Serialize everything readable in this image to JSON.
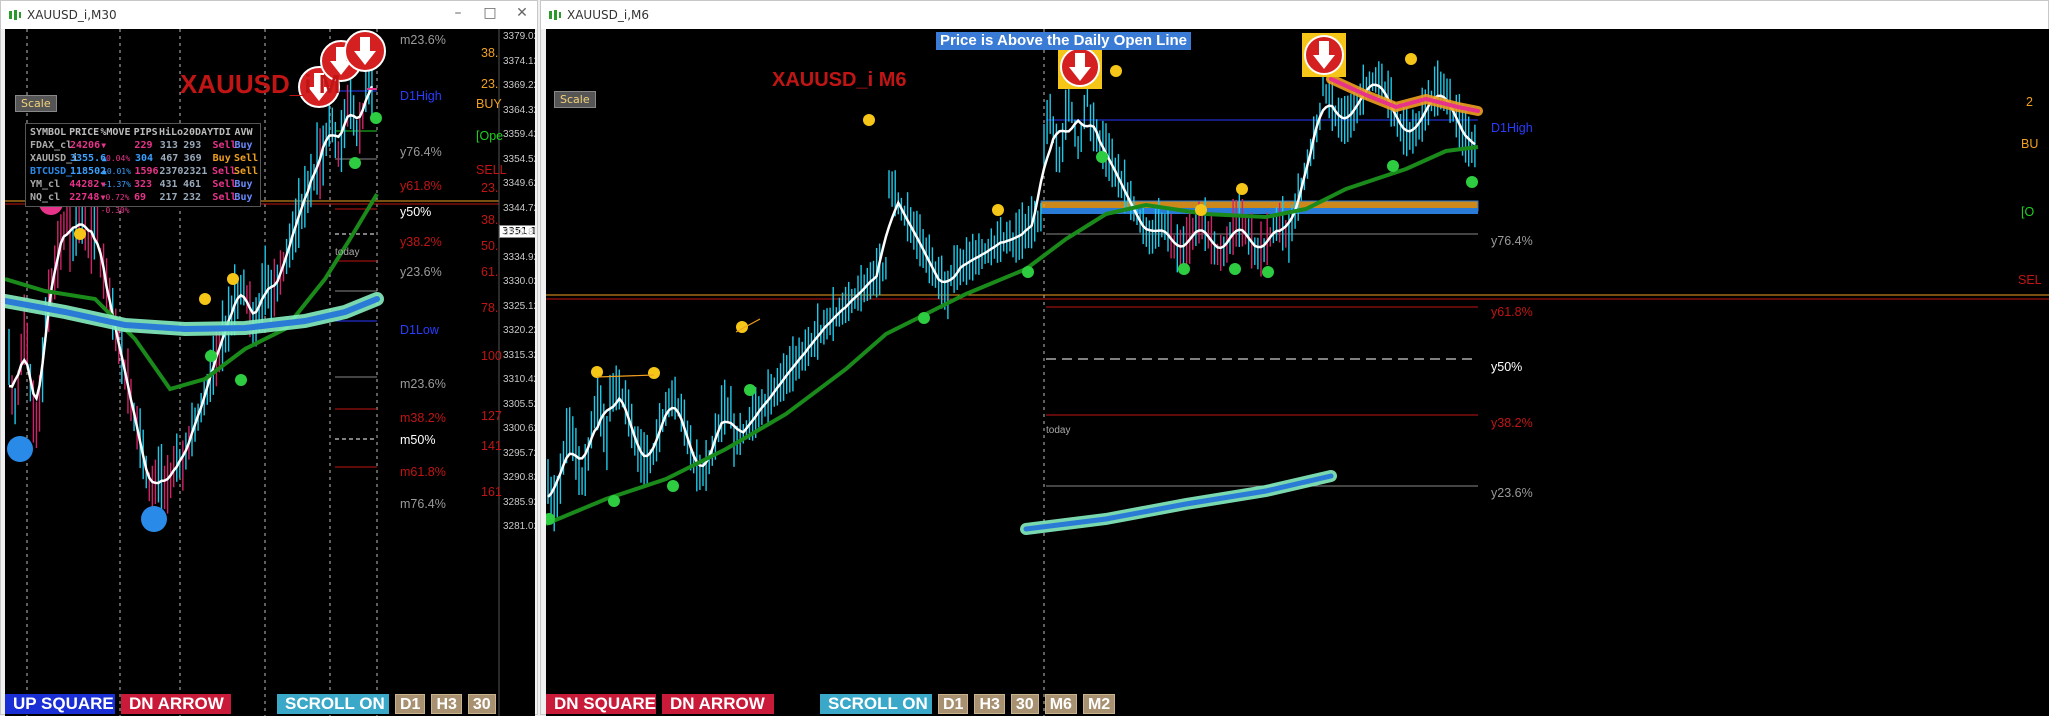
{
  "left_window": {
    "title": "XAUUSD_i,M30",
    "symbol_title": "XAUUSD_i M",
    "scale_label": "Scale",
    "today_label": "today",
    "price_tag": "3351.12",
    "price_axis": [
      "3379.02",
      "3374.12",
      "3369.22",
      "3364.32",
      "3359.42",
      "3354.52",
      "3349.62",
      "3344.72",
      "3339.82",
      "3334.92",
      "3330.02",
      "3325.12",
      "3320.22",
      "3315.32",
      "3310.42",
      "3305.52",
      "3300.62",
      "3295.72",
      "3290.82",
      "3285.92",
      "3281.02"
    ],
    "fib_labels": [
      {
        "text": "m23.6%",
        "color": "#9a9a9a"
      },
      {
        "text": "D1High",
        "color": "#2a3cff"
      },
      {
        "text": "y76.4%",
        "color": "#9a9a9a"
      },
      {
        "text": "y61.8%",
        "color": "#c11515"
      },
      {
        "text": "y50%",
        "color": "#ffffff"
      },
      {
        "text": "y38.2%",
        "color": "#c11515"
      },
      {
        "text": "y23.6%",
        "color": "#9a9a9a"
      },
      {
        "text": "D1Low",
        "color": "#2a3cff"
      },
      {
        "text": "m23.6%",
        "color": "#9a9a9a"
      },
      {
        "text": "m38.2%",
        "color": "#c11515"
      },
      {
        "text": "m50%",
        "color": "#ffffff"
      },
      {
        "text": "m61.8%",
        "color": "#c11515"
      },
      {
        "text": "m76.4%",
        "color": "#9a9a9a"
      }
    ],
    "side_numbers": [
      "38.",
      "23.",
      "23.",
      "38.",
      "50.",
      "61.",
      "78.",
      "100",
      "127",
      "141",
      "161"
    ],
    "side_words": [
      {
        "text": "BUY",
        "color": "#f0a020"
      },
      {
        "text": "[Ope",
        "color": "#1fd11f"
      },
      {
        "text": "SELL",
        "color": "#c11515"
      }
    ],
    "dashboard": {
      "headers": [
        "SYMBOL",
        "PRICE",
        "%MOVE",
        "PIPS",
        "HiLo",
        "20DAY",
        "TDI",
        "AVW"
      ],
      "rows": [
        {
          "symbol": "FDAX_cl",
          "price": "24206",
          "move": "▼ -0.04%",
          "pips": "229",
          "hilo": "313",
          "day20": "293",
          "tdi": "Sell",
          "avw": "Buy"
        },
        {
          "symbol": "XAUUSD_i",
          "price": "3355.6",
          "move": "▲ +0.01%",
          "pips": "304",
          "hilo": "467",
          "day20": "369",
          "tdi": "Buy",
          "avw": "Sell"
        },
        {
          "symbol": "BTCUSD_",
          "price": "118502",
          "move": "▲ +1.37%",
          "pips": "1596",
          "hilo": "2370",
          "day20": "2321",
          "tdi": "Sell",
          "avw": "Sell"
        },
        {
          "symbol": "YM_cl",
          "price": "44282",
          "move": "▼ -0.72%",
          "pips": "323",
          "hilo": "431",
          "day20": "461",
          "tdi": "Sell",
          "avw": "Buy"
        },
        {
          "symbol": "NQ_cl",
          "price": "22748",
          "move": "▼ -0.30%",
          "pips": "69",
          "hilo": "217",
          "day20": "232",
          "tdi": "Sell",
          "avw": "Buy"
        }
      ]
    },
    "buttons": {
      "up_square": "UP SQUARE",
      "dn_arrow": "DN ARROW",
      "scroll_on": "SCROLL ON",
      "tf": [
        "D1",
        "H3",
        "30"
      ]
    }
  },
  "right_window": {
    "title": "XAUUSD_i,M6",
    "symbol_title": "XAUUSD_i M6",
    "scale_label": "Scale",
    "today_label": "today",
    "banner": "Price is Above the Daily Open Line",
    "fib_labels": [
      {
        "text": "D1High",
        "color": "#2a3cff"
      },
      {
        "text": "y76.4%",
        "color": "#9a9a9a"
      },
      {
        "text": "y61.8%",
        "color": "#c11515"
      },
      {
        "text": "y50%",
        "color": "#ffffff"
      },
      {
        "text": "y38.2%",
        "color": "#c11515"
      },
      {
        "text": "y23.6%",
        "color": "#9a9a9a"
      }
    ],
    "side_words": [
      {
        "text": "2",
        "color": "#f0a020"
      },
      {
        "text": "BU",
        "color": "#f0a020"
      },
      {
        "text": "[O",
        "color": "#1fd11f"
      },
      {
        "text": "SEL",
        "color": "#c11515"
      }
    ],
    "buttons": {
      "dn_square": "DN SQUARE",
      "dn_arrow": "DN ARROW",
      "scroll_on": "SCROLL ON",
      "tf": [
        "D1",
        "H3",
        "30",
        "M6",
        "M2"
      ]
    }
  },
  "colors": {
    "candle_up": "#1ec8e8",
    "candle_down": "#d0246a",
    "ma_white": "#ffffff",
    "ma_green": "#1a8a1a",
    "band_blue": "#2a7bd6",
    "band_glow": "#86f0c0",
    "dot_yellow": "#f5c518",
    "dot_green": "#2ecc40",
    "arrow_red": "#d42020"
  }
}
